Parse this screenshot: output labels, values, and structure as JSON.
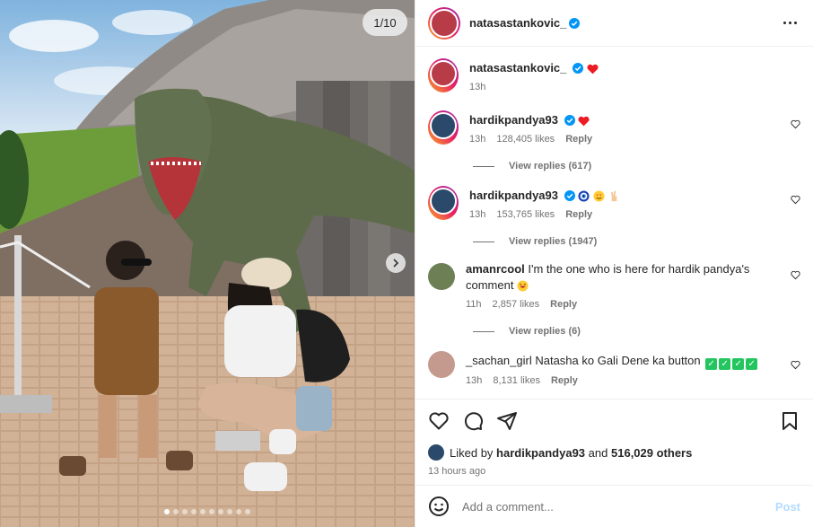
{
  "media": {
    "counter": "1/10",
    "slide_count": 10,
    "active_slide": 1
  },
  "header": {
    "username": "natasastankovic_"
  },
  "caption": {
    "username": "natasastankovic_",
    "time": "13h"
  },
  "comments": [
    {
      "username": "hardikpandya93",
      "time": "13h",
      "likes": "128,405 likes",
      "reply": "Reply",
      "view_replies": "View replies (617)"
    },
    {
      "username": "hardikpandya93",
      "time": "13h",
      "likes": "153,765 likes",
      "reply": "Reply",
      "view_replies": "View replies (1947)"
    },
    {
      "username": "amanrcool",
      "text": "I'm the one who is here for hardik pandya's comment",
      "time": "11h",
      "likes": "2,857 likes",
      "reply": "Reply",
      "view_replies": "View replies (6)"
    },
    {
      "username": "_sachan_girl",
      "text": "Natasha ko Gali Dene ka button",
      "time": "13h",
      "likes": "8,131 likes",
      "reply": "Reply"
    }
  ],
  "liked_by": {
    "prefix": "Liked by",
    "user": "hardikpandya93",
    "middle": "and",
    "others": "516,029 others"
  },
  "post_time": "13 hours ago",
  "add_comment": {
    "placeholder": "Add a comment...",
    "post_label": "Post"
  },
  "colors": {
    "verified": "#0095f6",
    "heart": "#ed4956",
    "post_disabled": "#b3dbff"
  }
}
